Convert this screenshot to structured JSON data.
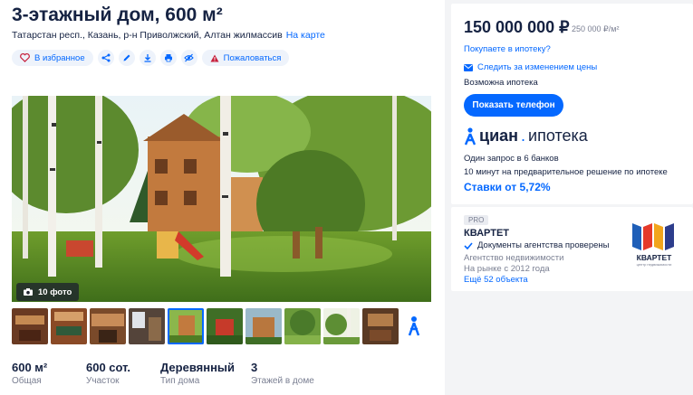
{
  "listing": {
    "title": "3-этажный дом, 600 м²",
    "address": "Татарстан респ., Казань, р-н Приволжский, Алтан жилмассив",
    "map_link": "На карте"
  },
  "actions": {
    "favorite": "В избранное",
    "report": "Пожаловаться"
  },
  "gallery": {
    "photo_count": "10 фото",
    "thumbnails": [
      "interior",
      "interior",
      "interior",
      "interior",
      "house-exterior",
      "gazebo",
      "house-exterior",
      "garden",
      "garden",
      "interior"
    ]
  },
  "stats": [
    {
      "value": "600 м²",
      "label": "Общая"
    },
    {
      "value": "600 сот.",
      "label": "Участок"
    },
    {
      "value": "Деревянный",
      "label": "Тип дома"
    },
    {
      "value": "3",
      "label": "Этажей в доме"
    }
  ],
  "price_card": {
    "price": "150 000 000 ₽",
    "price_per_m2": "250 000 ₽/м²",
    "mortgage_question": "Покупаете в ипотеку?",
    "follow_price": "Следить за изменением цены",
    "mortgage_possible": "Возможна ипотека",
    "show_phone": "Показать телефон",
    "brand_word1": "циан",
    "brand_word2": "ипотека",
    "banks_text": "Один запрос в 6 банков",
    "decision_text": "10 минут на предварительное решение по ипотеке",
    "rates": "Ставки от 5,72%"
  },
  "agent_card": {
    "badge": "PRO",
    "name": "КВАРТЕТ",
    "verified": "Документы агентства проверены",
    "type": "Агентство недвижимости",
    "since": "На рынке с 2012 года",
    "more": "Ещё 52 объекта",
    "logo_text": "КВАРТЕТ",
    "logo_sub": "центр недвижимости"
  },
  "colors": {
    "accent": "#0468ff",
    "text": "#152242",
    "muted": "#7a7f92"
  }
}
